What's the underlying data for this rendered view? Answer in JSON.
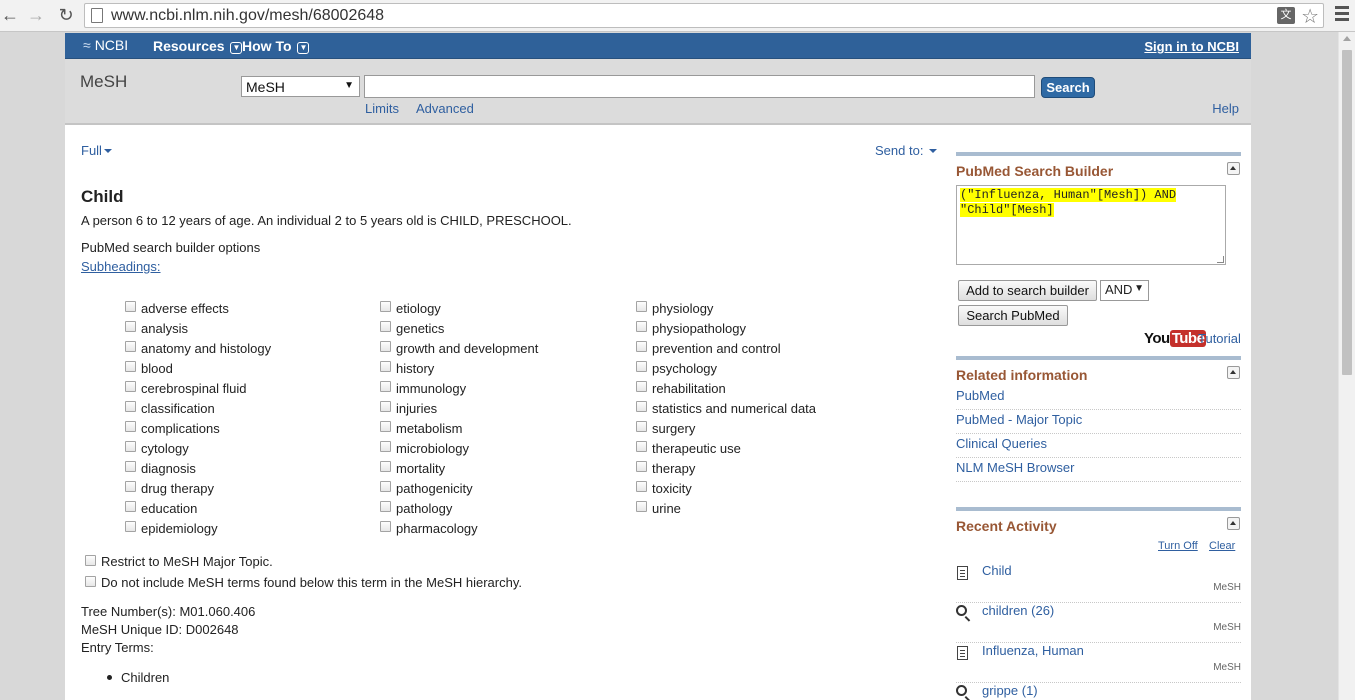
{
  "browser": {
    "url": "www.ncbi.nlm.nih.gov/mesh/68002648"
  },
  "header": {
    "logo": "NCBI",
    "resources": "Resources",
    "how_to": "How To",
    "sign_in": "Sign in to NCBI"
  },
  "search": {
    "db_title": "MeSH",
    "db_selected": "MeSH",
    "term_value": "",
    "search_button": "Search",
    "limits": "Limits",
    "advanced": "Advanced",
    "help": "Help"
  },
  "display": {
    "format": "Full",
    "send_to": "Send to:"
  },
  "record": {
    "title": "Child",
    "scope_note": "A person 6 to 12 years of age. An individual 2 to 5 years old is CHILD, PRESCHOOL.",
    "builder_options_label": "PubMed search builder options",
    "subheadings_label": "Subheadings:",
    "subheadings_col1": [
      "adverse effects",
      "analysis",
      "anatomy and histology",
      "blood",
      "cerebrospinal fluid",
      "classification",
      "complications",
      "cytology",
      "diagnosis",
      "drug therapy",
      "education",
      "epidemiology"
    ],
    "subheadings_col2": [
      "etiology",
      "genetics",
      "growth and development",
      "history",
      "immunology",
      "injuries",
      "metabolism",
      "microbiology",
      "mortality",
      "pathogenicity",
      "pathology",
      "pharmacology"
    ],
    "subheadings_col3": [
      "physiology",
      "physiopathology",
      "prevention and control",
      "psychology",
      "rehabilitation",
      "statistics and numerical data",
      "surgery",
      "therapeutic use",
      "therapy",
      "toxicity",
      "urine"
    ],
    "restrict_major": "Restrict to MeSH Major Topic.",
    "no_explode": "Do not include MeSH terms found below this term in the MeSH hierarchy.",
    "tree_number": "Tree Number(s): M01.060.406",
    "unique_id": "MeSH Unique ID: D002648",
    "entry_terms_label": "Entry Terms:",
    "entry_terms": [
      "Children"
    ]
  },
  "builder": {
    "title": "PubMed Search Builder",
    "query_line1": "(\"Influenza, Human\"[Mesh]) AND",
    "query_line2": "\"Child\"[Mesh]",
    "add_button": "Add to search builder",
    "operator": "AND",
    "search_pubmed": "Search PubMed",
    "youtube_you": "You",
    "youtube_tube": "Tube",
    "tutorial": "Tutorial"
  },
  "related": {
    "title": "Related information",
    "items": [
      "PubMed",
      "PubMed - Major Topic",
      "Clinical Queries",
      "NLM MeSH Browser"
    ]
  },
  "recent": {
    "title": "Recent Activity",
    "turn_off": "Turn Off",
    "clear": "Clear",
    "items": [
      {
        "label": "Child",
        "db": "MeSH",
        "icon": "document-icon"
      },
      {
        "label": "children (26)",
        "db": "MeSH",
        "icon": "search-icon"
      },
      {
        "label": "Influenza, Human",
        "db": "MeSH",
        "icon": "document-icon"
      },
      {
        "label": "grippe (1)",
        "db": "",
        "icon": "search-icon"
      }
    ]
  }
}
